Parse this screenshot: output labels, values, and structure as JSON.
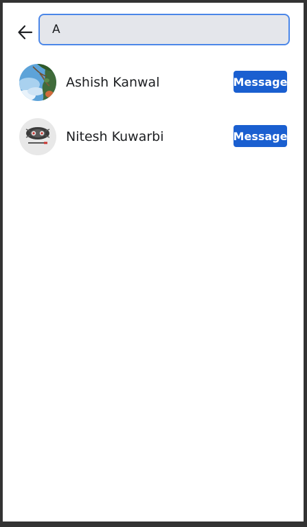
{
  "header": {
    "back_icon": "arrow-left-icon",
    "search_value": "A"
  },
  "results": [
    {
      "name": "Ashish Kanwal",
      "button_label": "Message",
      "avatar": "nature-photo-avatar"
    },
    {
      "name": "Nitesh Kuwarbi",
      "button_label": "Message",
      "avatar": "logo-avatar"
    }
  ],
  "colors": {
    "accent": "#1a5fd0",
    "search_border": "#4a86e8",
    "search_bg": "#e4e6eb",
    "frame_border": "#333333"
  }
}
